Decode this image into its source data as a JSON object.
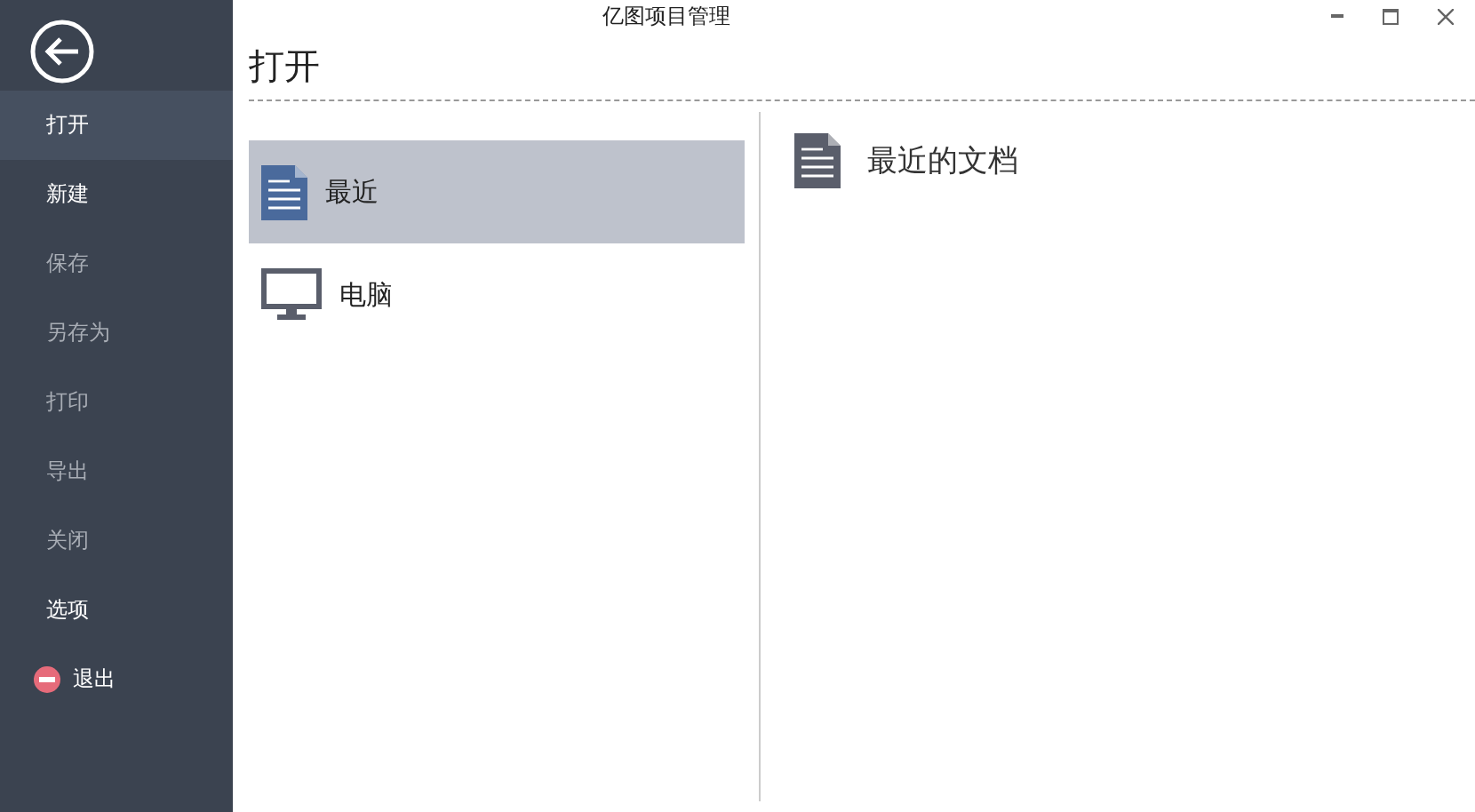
{
  "window": {
    "title": "亿图项目管理"
  },
  "sidebar": {
    "items": [
      {
        "label": "打开",
        "selected": true,
        "disabled": false,
        "kind": "plain"
      },
      {
        "label": "新建",
        "selected": false,
        "disabled": false,
        "kind": "plain"
      },
      {
        "label": "保存",
        "selected": false,
        "disabled": true,
        "kind": "plain"
      },
      {
        "label": "另存为",
        "selected": false,
        "disabled": true,
        "kind": "plain"
      },
      {
        "label": "打印",
        "selected": false,
        "disabled": true,
        "kind": "plain"
      },
      {
        "label": "导出",
        "selected": false,
        "disabled": true,
        "kind": "plain"
      },
      {
        "label": "关闭",
        "selected": false,
        "disabled": true,
        "kind": "plain"
      },
      {
        "label": "选项",
        "selected": false,
        "disabled": false,
        "kind": "plain"
      },
      {
        "label": "退出",
        "selected": false,
        "disabled": false,
        "kind": "exit"
      }
    ]
  },
  "page": {
    "title": "打开"
  },
  "locations": [
    {
      "label": "最近",
      "selected": true,
      "kind": "document"
    },
    {
      "label": "电脑",
      "selected": false,
      "kind": "computer"
    }
  ],
  "detail": {
    "title": "最近的文档"
  }
}
